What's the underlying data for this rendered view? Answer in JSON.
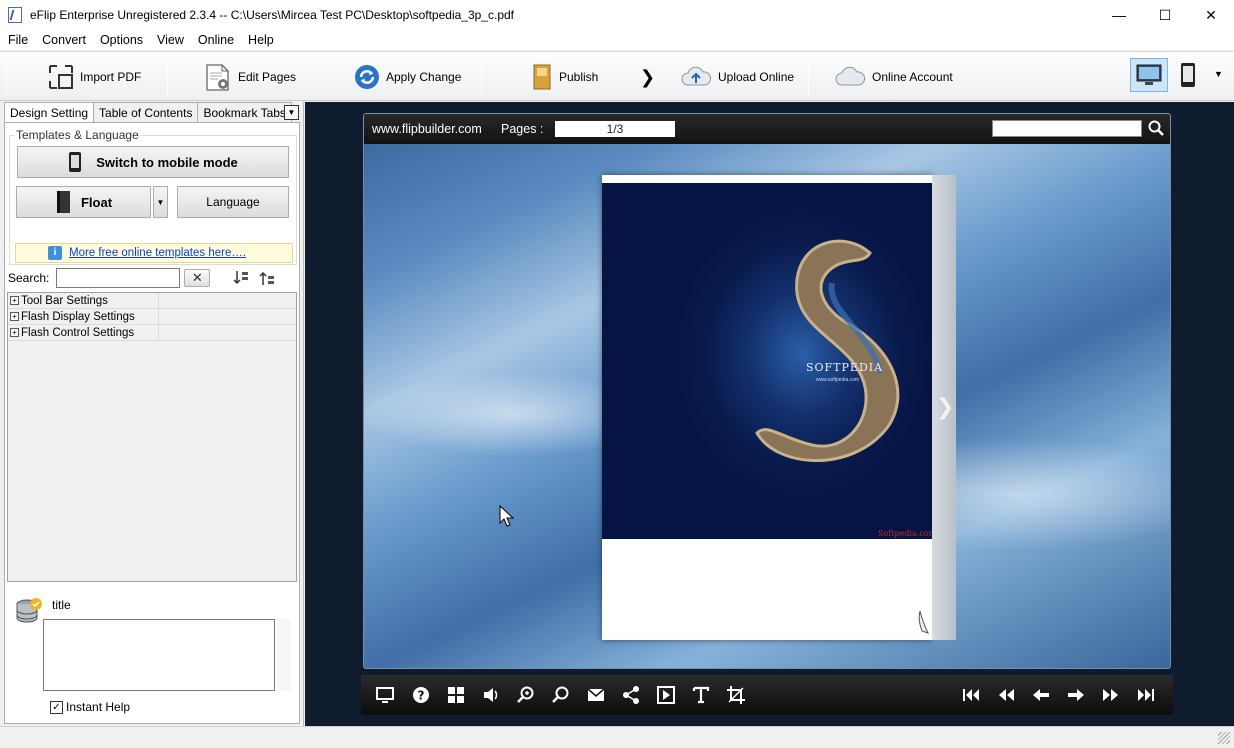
{
  "window": {
    "title": "eFlip Enterprise Unregistered 2.3.4  -- C:\\Users\\Mircea Test PC\\Desktop\\softpedia_3p_c.pdf",
    "minimize": "—",
    "maximize": "☐",
    "close": "✕"
  },
  "menu": [
    "File",
    "Convert",
    "Options",
    "View",
    "Online",
    "Help"
  ],
  "toolbar": {
    "import_pdf": "Import PDF",
    "edit_pages": "Edit Pages",
    "apply_change": "Apply Change",
    "publish": "Publish",
    "publish_arrow": "❯",
    "upload_online": "Upload Online",
    "online_account": "Online Account",
    "more": "▼"
  },
  "left_panel": {
    "tabs": [
      "Design Setting",
      "Table of Contents",
      "Bookmark Tabs"
    ],
    "tab_dropdown": "▼",
    "templates_legend": "Templates & Language",
    "switch_mobile": "Switch to mobile mode",
    "float": "Float",
    "float_dropdown": "▼",
    "language": "Language",
    "more_templates": "More free online templates here….",
    "search_label": "Search:",
    "search_value": "",
    "search_clear": "✕",
    "tree": [
      "Tool Bar Settings",
      "Flash Display Settings",
      "Flash Control Settings"
    ],
    "tree_expander": "+",
    "help_title": "title",
    "instant_help": "Instant Help",
    "instant_help_check": "✓"
  },
  "viewer": {
    "site": "www.flipbuilder.com",
    "pages_label": "Pages :",
    "pages_value": "1/3",
    "cover_brand": "SOFTPEDIA",
    "cover_url": "www.softpedia.com",
    "cover_footer": "Softpedia.com",
    "next_page": "❯"
  },
  "colors": {
    "viewer_bg": "#0f1c2e",
    "cover_blue": "#081a4c",
    "link_blue": "#0645c8",
    "selected_device": "#cde6f7"
  }
}
